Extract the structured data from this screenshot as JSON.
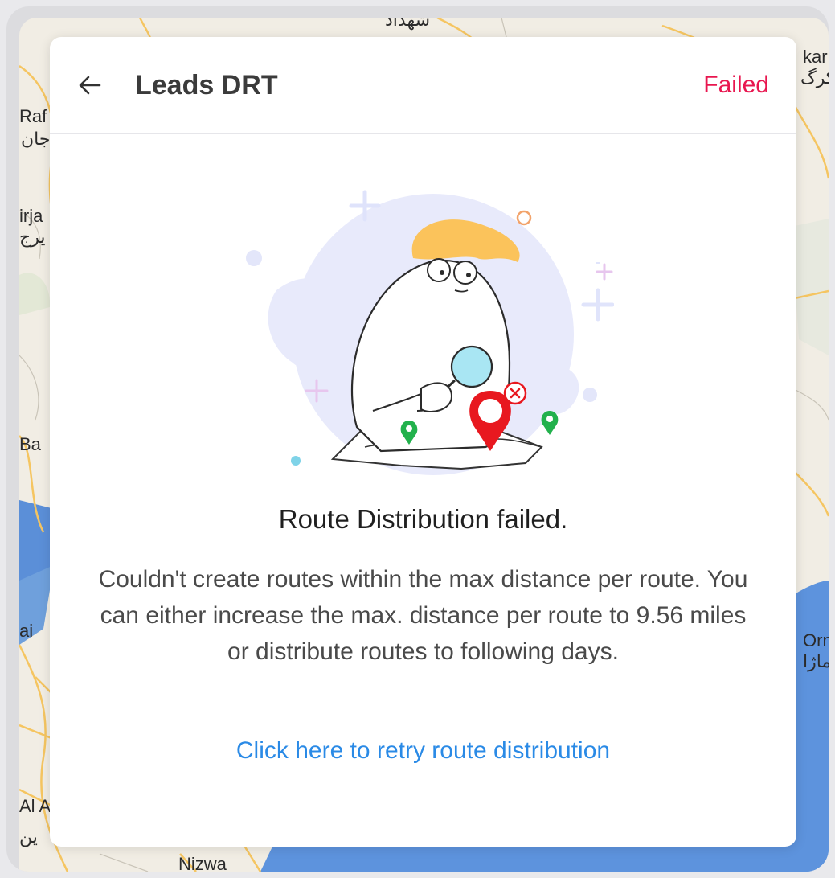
{
  "map": {
    "labels": [
      "Raf",
      "جان",
      "irja",
      "یرج",
      "Ba",
      "ai",
      "Al A",
      "ین",
      "Nizwa",
      "kar",
      "کرگ",
      "Orm",
      "ماژا",
      "شهداد"
    ]
  },
  "header": {
    "title": "Leads DRT",
    "status": "Failed"
  },
  "content": {
    "heading": "Route Distribution failed.",
    "message": "Couldn't create routes within the max distance per route. You can either increase the max. distance per route to 9.56 miles or distribute routes to following days.",
    "retry_link": "Click here to retry route distribution"
  },
  "colors": {
    "status_failed": "#e8164f",
    "link": "#2a8ae6",
    "pin_red": "#e8181f",
    "pin_green": "#22b14c"
  },
  "icons": [
    "back-arrow-icon",
    "route-failed-illustration"
  ]
}
